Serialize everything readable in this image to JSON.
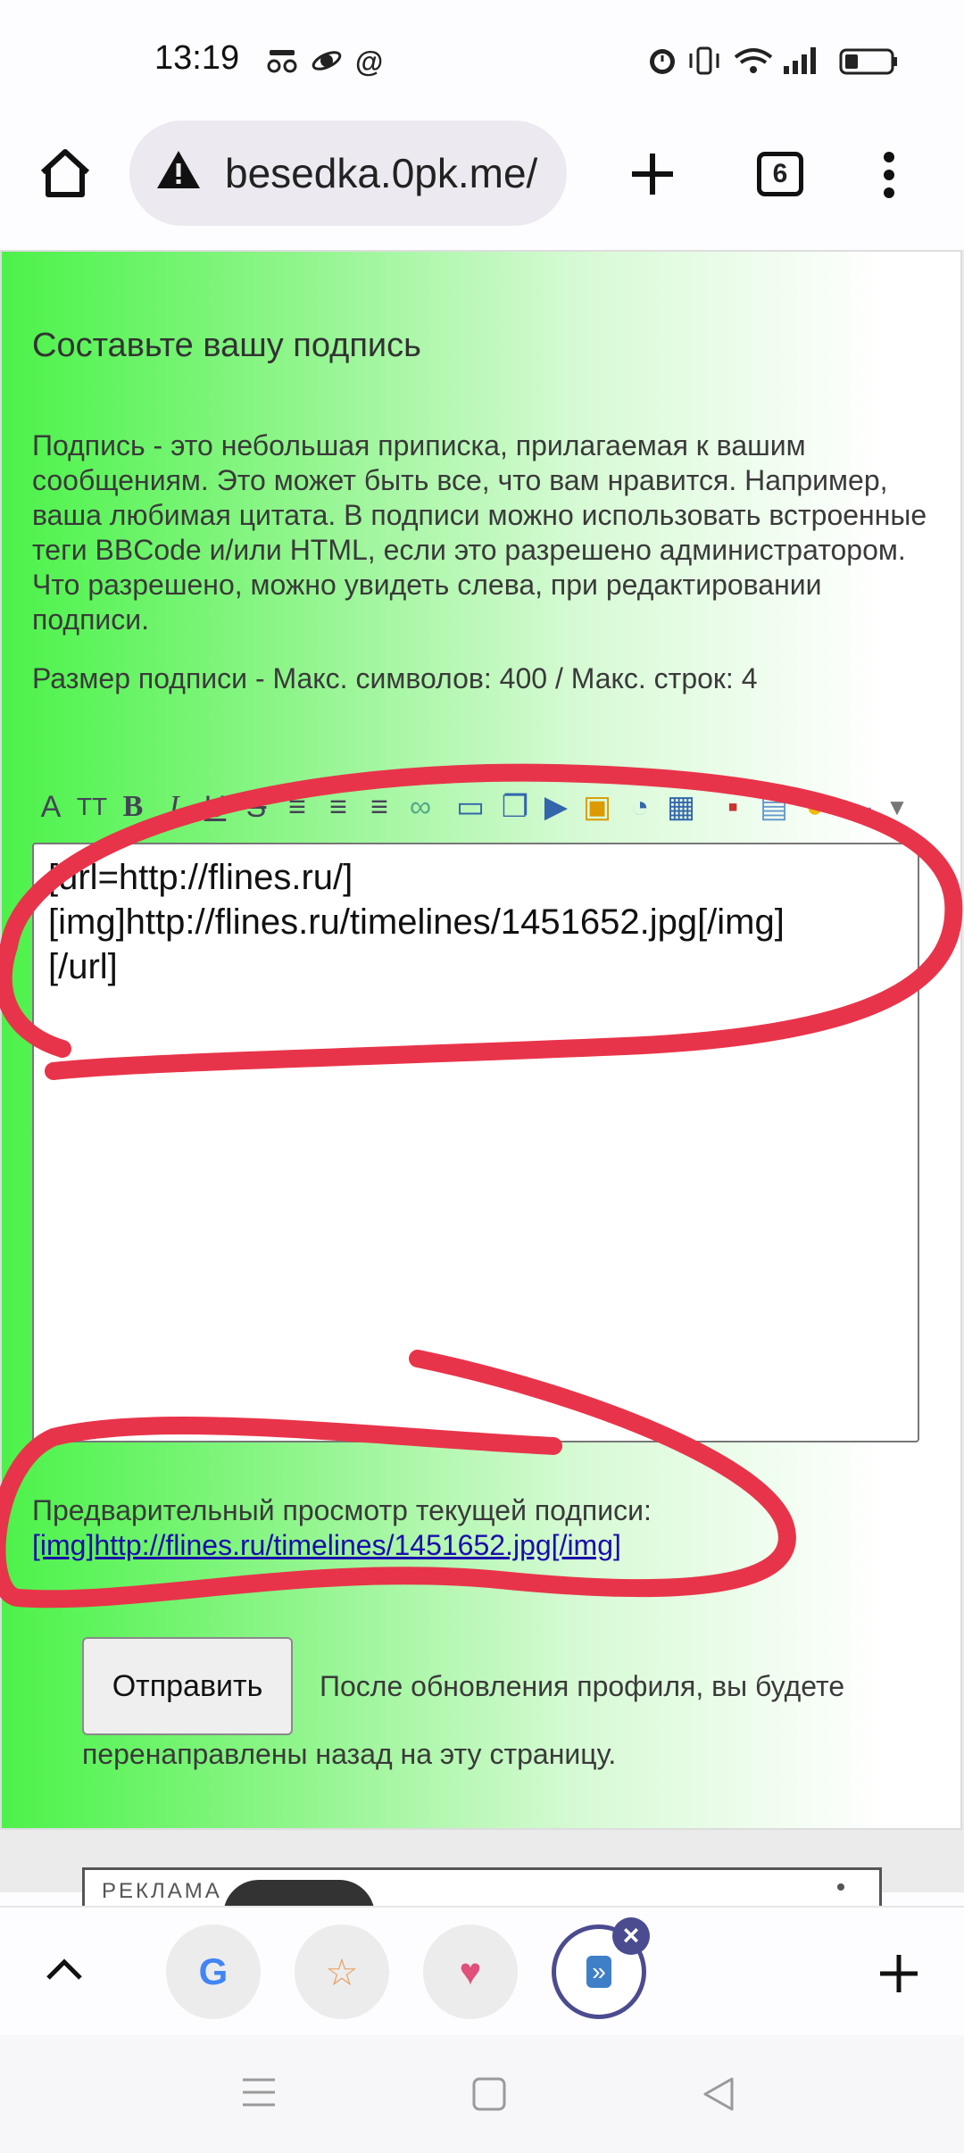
{
  "status_bar": {
    "time": "13:19"
  },
  "browser": {
    "url": "besedka.0pk.me/",
    "tab_count": "6"
  },
  "page": {
    "heading": "Составьте вашу подпись",
    "description": "Подпись - это небольшая приписка, прилагаемая к вашим сообщениям. Это может быть все, что вам нравится. Например, ваша любимая цитата. В подписи можно использовать встроенные теги BBCode и/или HTML, если это разрешено администратором. Что разрешено, можно увидеть слева, при редактировании подписи.",
    "size_limits": "Размер подписи - Макс. символов: 400 / Макс. строк: 4",
    "textarea_value": "[url=http://flines.ru/]\n[img]http://flines.ru/timelines/1451652.jpg[/img]\n[/url]",
    "preview_label": "Предварительный просмотр текущей подписи:",
    "preview_link": "[img]http://flines.ru/timelines/1451652.jpg[/img]",
    "submit_label": "Отправить",
    "after_note_1": "После обновления профиля, вы будете",
    "after_note_2": "перенаправлены назад на эту страницу.",
    "ad_label": "РЕКЛАМА"
  },
  "editor_toolbar": [
    "font-icon",
    "font-size-icon",
    "bold-icon",
    "italic-icon",
    "underline-icon",
    "strikethrough-icon",
    "align-left-icon",
    "align-center-icon",
    "align-right-icon",
    "link-icon",
    "book-icon",
    "copy-icon",
    "play-icon",
    "lock-icon",
    "speech-icon",
    "image-icon",
    "color-icon",
    "table-icon",
    "smiley-icon",
    "keyboard-icon",
    "more-icon"
  ],
  "colors": {
    "annotation_red": "#e8344a",
    "panel_green": "#4df14a",
    "link_blue": "#1a0dab"
  }
}
